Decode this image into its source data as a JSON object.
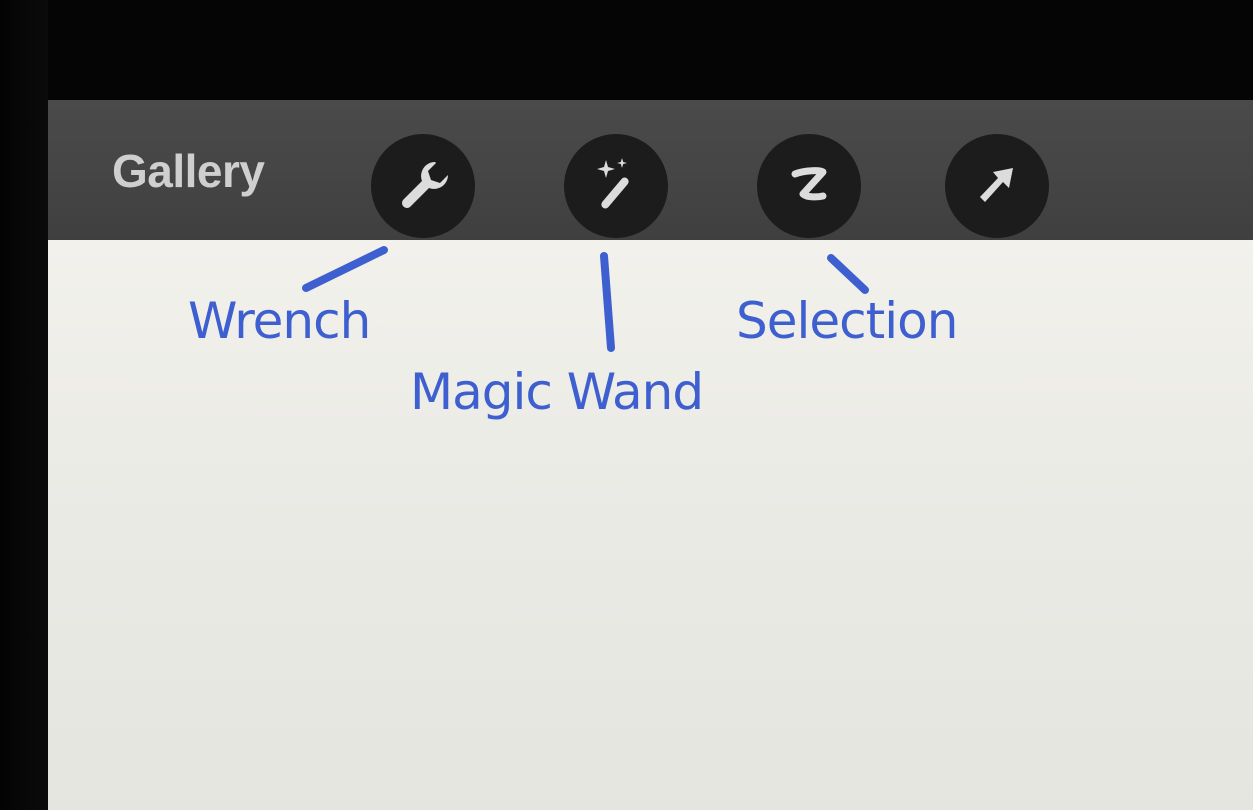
{
  "toolbar": {
    "gallery_label": "Gallery",
    "buttons": [
      {
        "icon": "wrench-icon"
      },
      {
        "icon": "magic-wand-icon"
      },
      {
        "icon": "selection-icon"
      },
      {
        "icon": "transform-arrow-icon"
      }
    ]
  },
  "annotations": {
    "wrench": "Wrench",
    "magic_wand": "Magic Wand",
    "selection": "Selection",
    "color": "#3e5fcf"
  }
}
